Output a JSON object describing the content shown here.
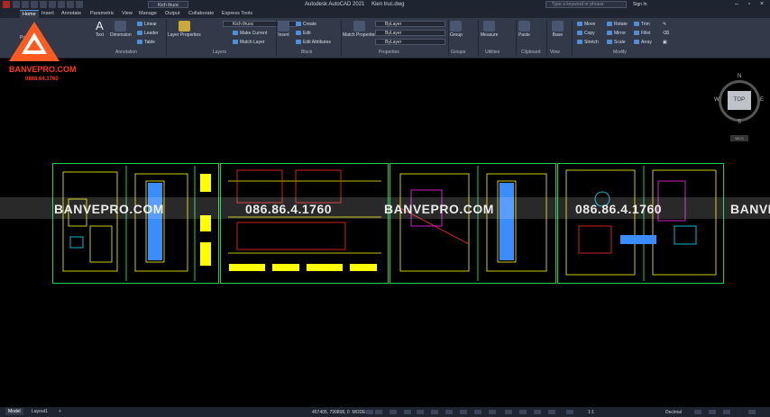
{
  "title_bar": {
    "app": "Autodesk AutoCAD 2021",
    "file": "Kien truc.dwg",
    "layer_dropdown": "Kich thuoc",
    "search_placeholder": "Type a keyword or phrase",
    "sign_in": "Sign In"
  },
  "tabs": [
    "Home",
    "Insert",
    "Annotate",
    "Parametric",
    "View",
    "Manage",
    "Output",
    "Collaborate",
    "Express Tools"
  ],
  "ribbon": {
    "draw_partial": "Pol",
    "annotation": {
      "text": "Text",
      "dimension": "Dimension",
      "linear": "Linear",
      "leader": "Leader",
      "table": "Table",
      "title": "Annotation"
    },
    "layers": {
      "layer_properties": "Layer Properties",
      "current_layer": "Kich thuoc",
      "make_current": "Make Current",
      "match_layer": "Match Layer",
      "title": "Layers"
    },
    "block": {
      "insert": "Insert",
      "create": "Create",
      "edit": "Edit",
      "edit_attributes": "Edit Attributes",
      "title": "Block"
    },
    "properties": {
      "match_properties": "Match Properties",
      "color": "ByLayer",
      "linetype": "ByLayer",
      "lineweight": "ByLayer",
      "title": "Properties"
    },
    "groups": {
      "group": "Group",
      "title": "Groups"
    },
    "utilities": {
      "measure": "Measure",
      "title": "Utilities"
    },
    "clipboard": {
      "paste": "Paste",
      "title": "Clipboard"
    },
    "view": {
      "base": "Base",
      "title": "View"
    },
    "modify": {
      "move": "Move",
      "rotate": "Rotate",
      "trim": "Trim",
      "copy": "Copy",
      "mirror": "Mirror",
      "fillet": "Fillet",
      "stretch": "Stretch",
      "scale": "Scale",
      "array": "Array",
      "title": "Modify"
    }
  },
  "watermark": {
    "brand": "BANVEPRO.COM",
    "phone": "0868.64.1760",
    "band_brand": "BANVEPRO.COM",
    "band_phone": "086.86.4.1760",
    "band_brand_cut": "BANVE"
  },
  "viewcube": {
    "top": "TOP",
    "n": "N",
    "s": "S",
    "e": "E",
    "w": "W",
    "wcs": "WCS"
  },
  "status_bar": {
    "tabs": [
      "Model",
      "Layout1"
    ],
    "add_tab": "+",
    "coordinates": "457405, 799808, 0",
    "space": "MODEL",
    "units": "Decimal",
    "scale": "1:1"
  },
  "colors": {
    "frame": "#18d24a",
    "drawing_primary": "#ffff00",
    "accent": "#4f8fd9",
    "brand": "#ff3b1f"
  }
}
